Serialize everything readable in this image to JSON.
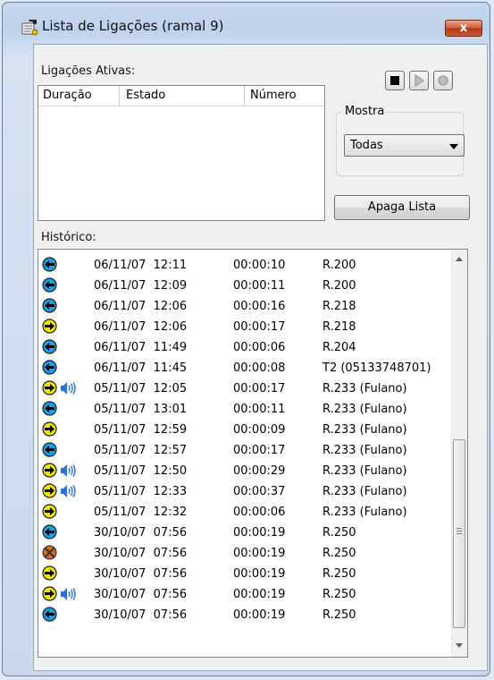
{
  "window": {
    "title": "Lista de Ligações (ramal 9)",
    "close_label": "x"
  },
  "active": {
    "label": "Ligações Ativas:",
    "columns": [
      "Duração",
      "Estado",
      "Número"
    ]
  },
  "mostra": {
    "label": "Mostra",
    "selected": "Todas"
  },
  "apaga_label": "Apaga Lista",
  "historico": {
    "label": "Histórico:",
    "rows": [
      {
        "icon": "incoming",
        "audio": false,
        "date": "06/11/07  12:11",
        "dur": "00:00:10",
        "num": "R.200"
      },
      {
        "icon": "incoming",
        "audio": false,
        "date": "06/11/07  12:09",
        "dur": "00:00:11",
        "num": "R.200"
      },
      {
        "icon": "incoming",
        "audio": false,
        "date": "06/11/07  12:06",
        "dur": "00:00:16",
        "num": "R.218"
      },
      {
        "icon": "outgoing",
        "audio": false,
        "date": "06/11/07  12:06",
        "dur": "00:00:17",
        "num": "R.218"
      },
      {
        "icon": "incoming",
        "audio": false,
        "date": "06/11/07  11:49",
        "dur": "00:00:06",
        "num": "R.204"
      },
      {
        "icon": "incoming",
        "audio": false,
        "date": "06/11/07  11:45",
        "dur": "00:00:08",
        "num": "T2 (05133748701)"
      },
      {
        "icon": "outgoing",
        "audio": true,
        "date": "05/11/07  12:05",
        "dur": "00:00:17",
        "num": "R.233 (Fulano)"
      },
      {
        "icon": "incoming",
        "audio": false,
        "date": "05/11/07  13:01",
        "dur": "00:00:11",
        "num": "R.233 (Fulano)"
      },
      {
        "icon": "outgoing",
        "audio": false,
        "date": "05/11/07  12:59",
        "dur": "00:00:09",
        "num": "R.233 (Fulano)"
      },
      {
        "icon": "incoming",
        "audio": false,
        "date": "05/11/07  12:57",
        "dur": "00:00:17",
        "num": "R.233 (Fulano)"
      },
      {
        "icon": "outgoing",
        "audio": true,
        "date": "05/11/07  12:50",
        "dur": "00:00:29",
        "num": "R.233 (Fulano)"
      },
      {
        "icon": "outgoing",
        "audio": true,
        "date": "05/11/07  12:33",
        "dur": "00:00:37",
        "num": "R.233 (Fulano)"
      },
      {
        "icon": "outgoing",
        "audio": false,
        "date": "05/11/07  12:32",
        "dur": "00:00:06",
        "num": "R.233 (Fulano)"
      },
      {
        "icon": "incoming",
        "audio": false,
        "date": "30/10/07  07:56",
        "dur": "00:00:19",
        "num": "R.250"
      },
      {
        "icon": "missed",
        "audio": false,
        "date": "30/10/07  07:56",
        "dur": "00:00:19",
        "num": "R.250"
      },
      {
        "icon": "outgoing",
        "audio": false,
        "date": "30/10/07  07:56",
        "dur": "00:00:19",
        "num": "R.250"
      },
      {
        "icon": "outgoing",
        "audio": true,
        "date": "30/10/07  07:56",
        "dur": "00:00:19",
        "num": "R.250"
      },
      {
        "icon": "incoming",
        "audio": false,
        "date": "30/10/07  07:56",
        "dur": "00:00:19",
        "num": "R.250"
      }
    ]
  },
  "colors": {
    "incoming": "#1aa0e6",
    "outgoing": "#f2e600",
    "missed": "#d86a2a"
  }
}
